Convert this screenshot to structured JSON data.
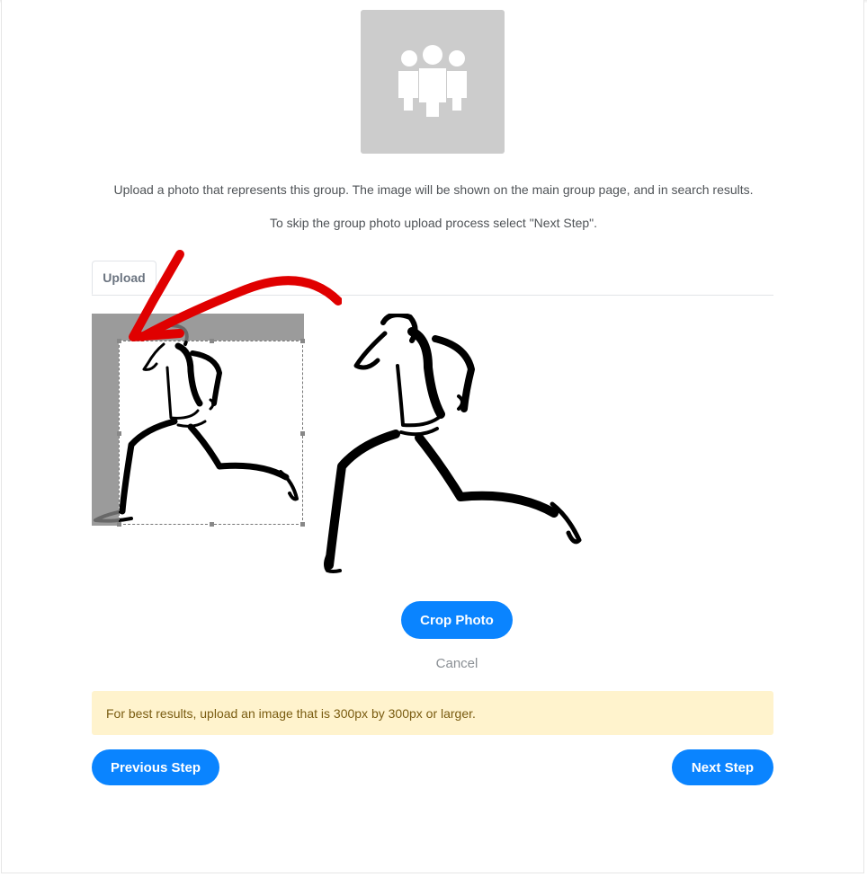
{
  "group_avatar": {
    "icon": "group-people-icon"
  },
  "intro": {
    "line1": "Upload a photo that represents this group. The image will be shown on the main group page, and in search results.",
    "line2": "To skip the group photo upload process select \"Next Step\"."
  },
  "tabs": [
    {
      "label": "Upload"
    }
  ],
  "cropper": {
    "source_image": "runner-sketch",
    "preview_image": "runner-sketch-cropped"
  },
  "actions": {
    "crop_label": "Crop Photo",
    "cancel_label": "Cancel"
  },
  "notice": "For best results, upload an image that is 300px by 300px or larger.",
  "nav": {
    "previous_label": "Previous Step",
    "next_label": "Next Step"
  },
  "colors": {
    "primary": "#0a84ff",
    "notice_bg": "#fff3cd",
    "notice_text": "#7a5c11",
    "annotation_arrow": "#e00000"
  }
}
